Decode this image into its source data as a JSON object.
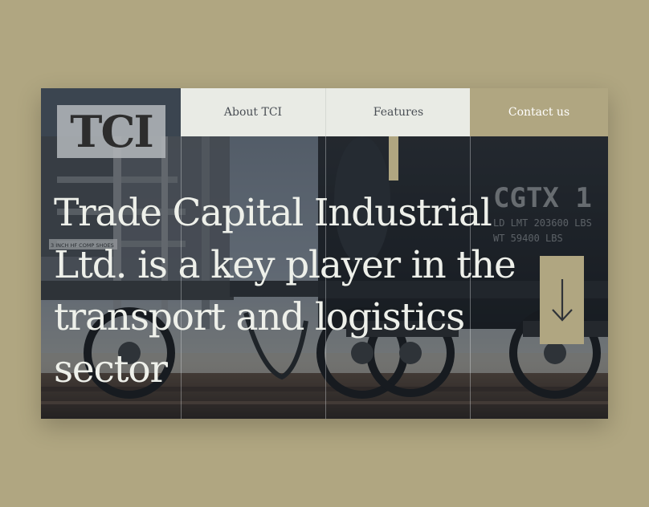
{
  "brand": {
    "logo_text": "TCI"
  },
  "nav": {
    "items": [
      {
        "label": "About TCI"
      },
      {
        "label": "Features"
      },
      {
        "label": "Contact us"
      }
    ]
  },
  "hero": {
    "headline": "Trade Capital Industrial Ltd. is a key player in the transport and logistics sector",
    "car_markings": {
      "reporting_mark": "CGTX 1",
      "ld_lmt": "LD LMT 203600 LBS",
      "wt": "WT 59400 LBS",
      "stencil": "3 INCH HF COMP SHOES"
    }
  },
  "scroll_button": {
    "icon": "arrow-down-icon"
  },
  "colors": {
    "background": "#b0a681",
    "accent": "#b0a681",
    "nav_light": "#e9ebe5",
    "headline": "#eef0ea",
    "logo_cell": "#3b4550"
  }
}
